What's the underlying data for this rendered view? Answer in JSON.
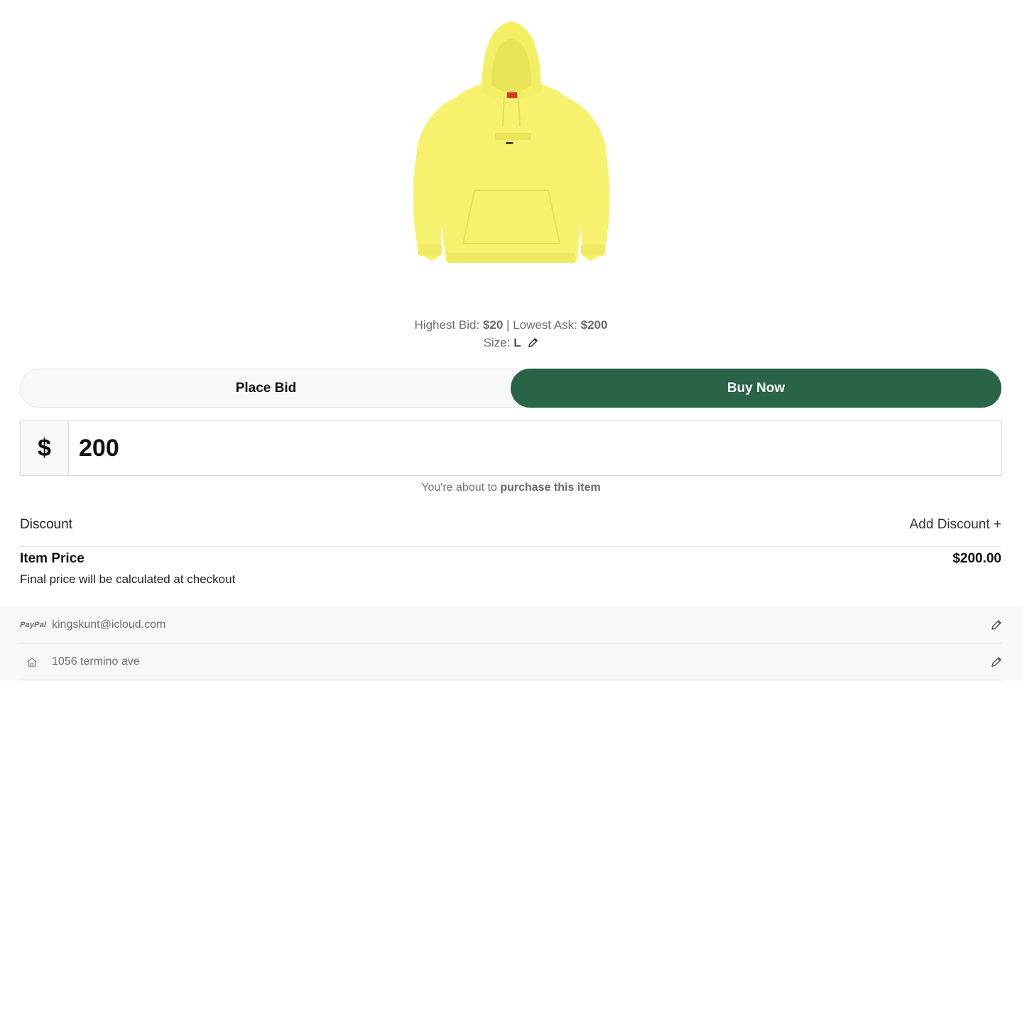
{
  "product": {
    "image_alt": "yellow-hoodie",
    "hoodie_color": "#f6f26e"
  },
  "market": {
    "highest_bid_label": "Highest Bid:",
    "highest_bid_value": "$20",
    "separator": "|",
    "lowest_ask_label": "Lowest Ask:",
    "lowest_ask_value": "$200",
    "size_label": "Size:",
    "size_value": "L"
  },
  "mode_toggle": {
    "place_bid_label": "Place Bid",
    "buy_now_label": "Buy Now",
    "active": "Buy Now",
    "active_color": "#2a6446"
  },
  "price_input": {
    "currency_symbol": "$",
    "value": "200"
  },
  "purchase_note": {
    "prefix": "You're about to",
    "emphasis": "purchase this item"
  },
  "discount": {
    "label": "Discount",
    "add_label": "Add Discount +"
  },
  "item_price": {
    "label": "Item Price",
    "value": "$200.00",
    "note": "Final price will be calculated at checkout"
  },
  "payment": {
    "method_logo": "PayPal",
    "account": "kingskunt@icloud.com",
    "icon": "paypal-icon"
  },
  "shipping": {
    "address": "1056 termino ave",
    "icon": "home-icon"
  }
}
